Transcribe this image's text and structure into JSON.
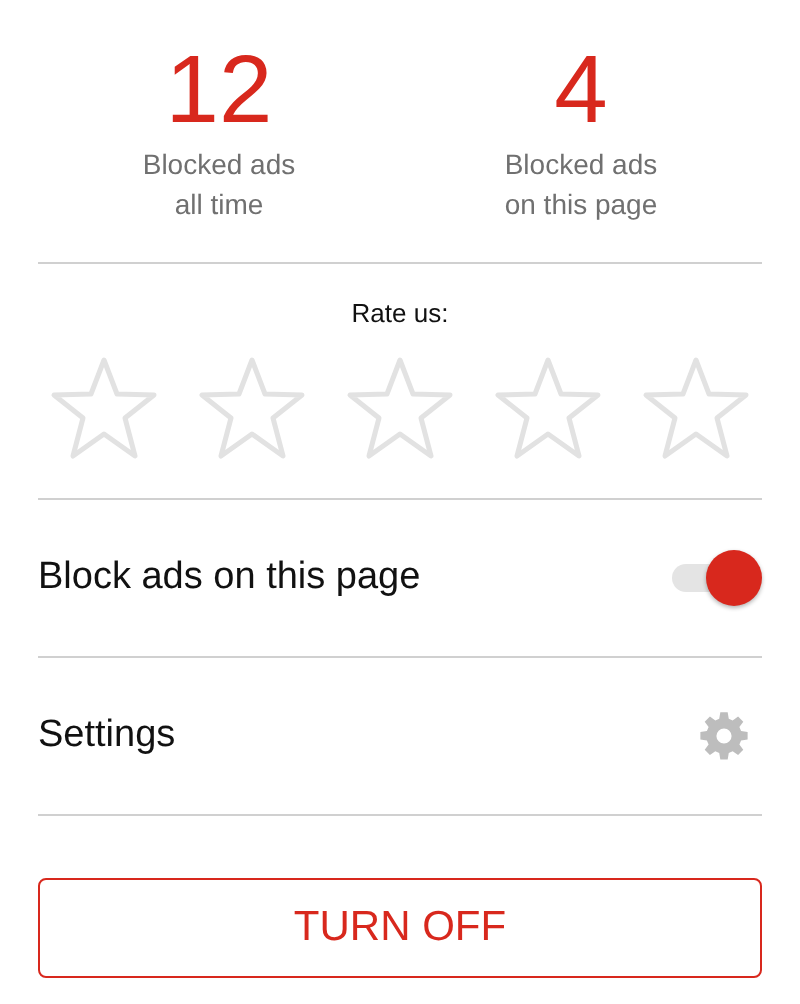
{
  "stats": [
    {
      "value": "12",
      "label": "Blocked ads\nall time"
    },
    {
      "value": "4",
      "label": "Blocked ads\non this page"
    }
  ],
  "rating": {
    "label": "Rate us:",
    "stars": 0
  },
  "settings_rows": [
    {
      "kind": "toggle",
      "label": "Block ads on this page",
      "on": true
    },
    {
      "kind": "link",
      "label": "Settings"
    }
  ],
  "button": "TURN OFF"
}
